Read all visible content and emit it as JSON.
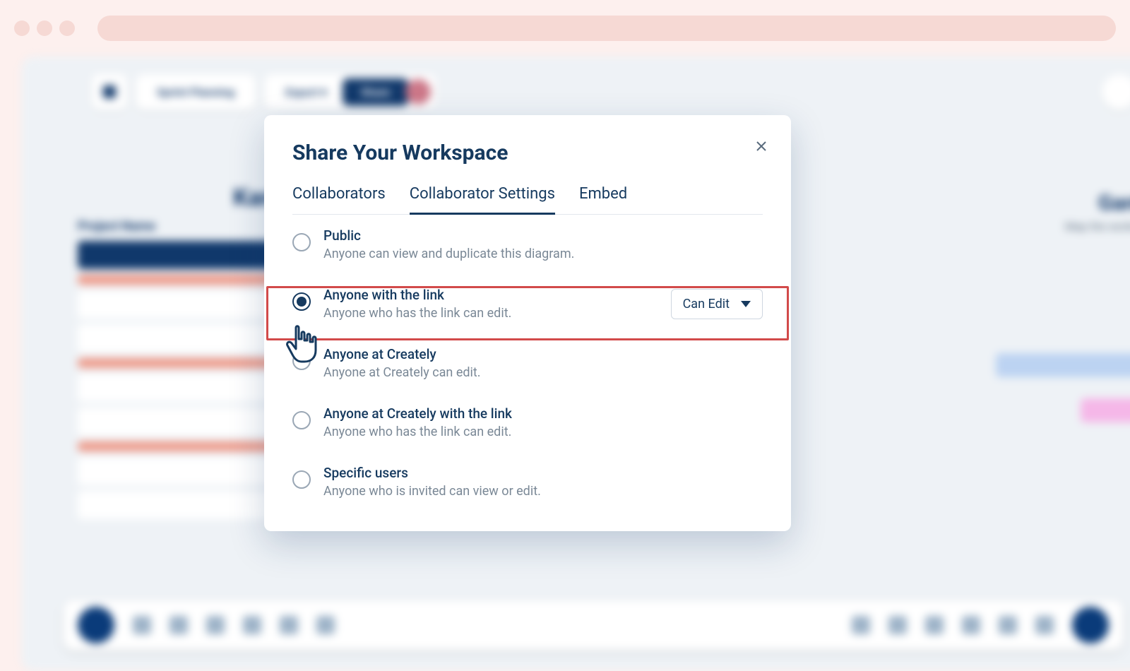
{
  "chrome": {},
  "toolbar": {
    "doc_title": "Sprint Planning",
    "export_label": "Export",
    "share_label": "Share"
  },
  "bg": {
    "heading_left": "Kanban",
    "heading_right": "Gantt Chart To",
    "heading_right_sub": "Map the workstreams and milesto",
    "side_label": "Project Name"
  },
  "modal": {
    "title": "Share Your Workspace",
    "tabs": [
      {
        "label": "Collaborators",
        "active": false
      },
      {
        "label": "Collaborator Settings",
        "active": true
      },
      {
        "label": "Embed",
        "active": false
      }
    ],
    "options": [
      {
        "title": "Public",
        "desc": "Anyone can view and duplicate this diagram.",
        "selected": false
      },
      {
        "title": "Anyone with the link",
        "desc": "Anyone who has the link can edit.",
        "selected": true,
        "permission": "Can Edit"
      },
      {
        "title": "Anyone at Creately",
        "desc": "Anyone at Creately can edit.",
        "selected": false
      },
      {
        "title": "Anyone at Creately with the link",
        "desc": "Anyone who has the link can edit.",
        "selected": false
      },
      {
        "title": "Specific users",
        "desc": "Anyone who is invited can view or edit.",
        "selected": false
      }
    ]
  }
}
